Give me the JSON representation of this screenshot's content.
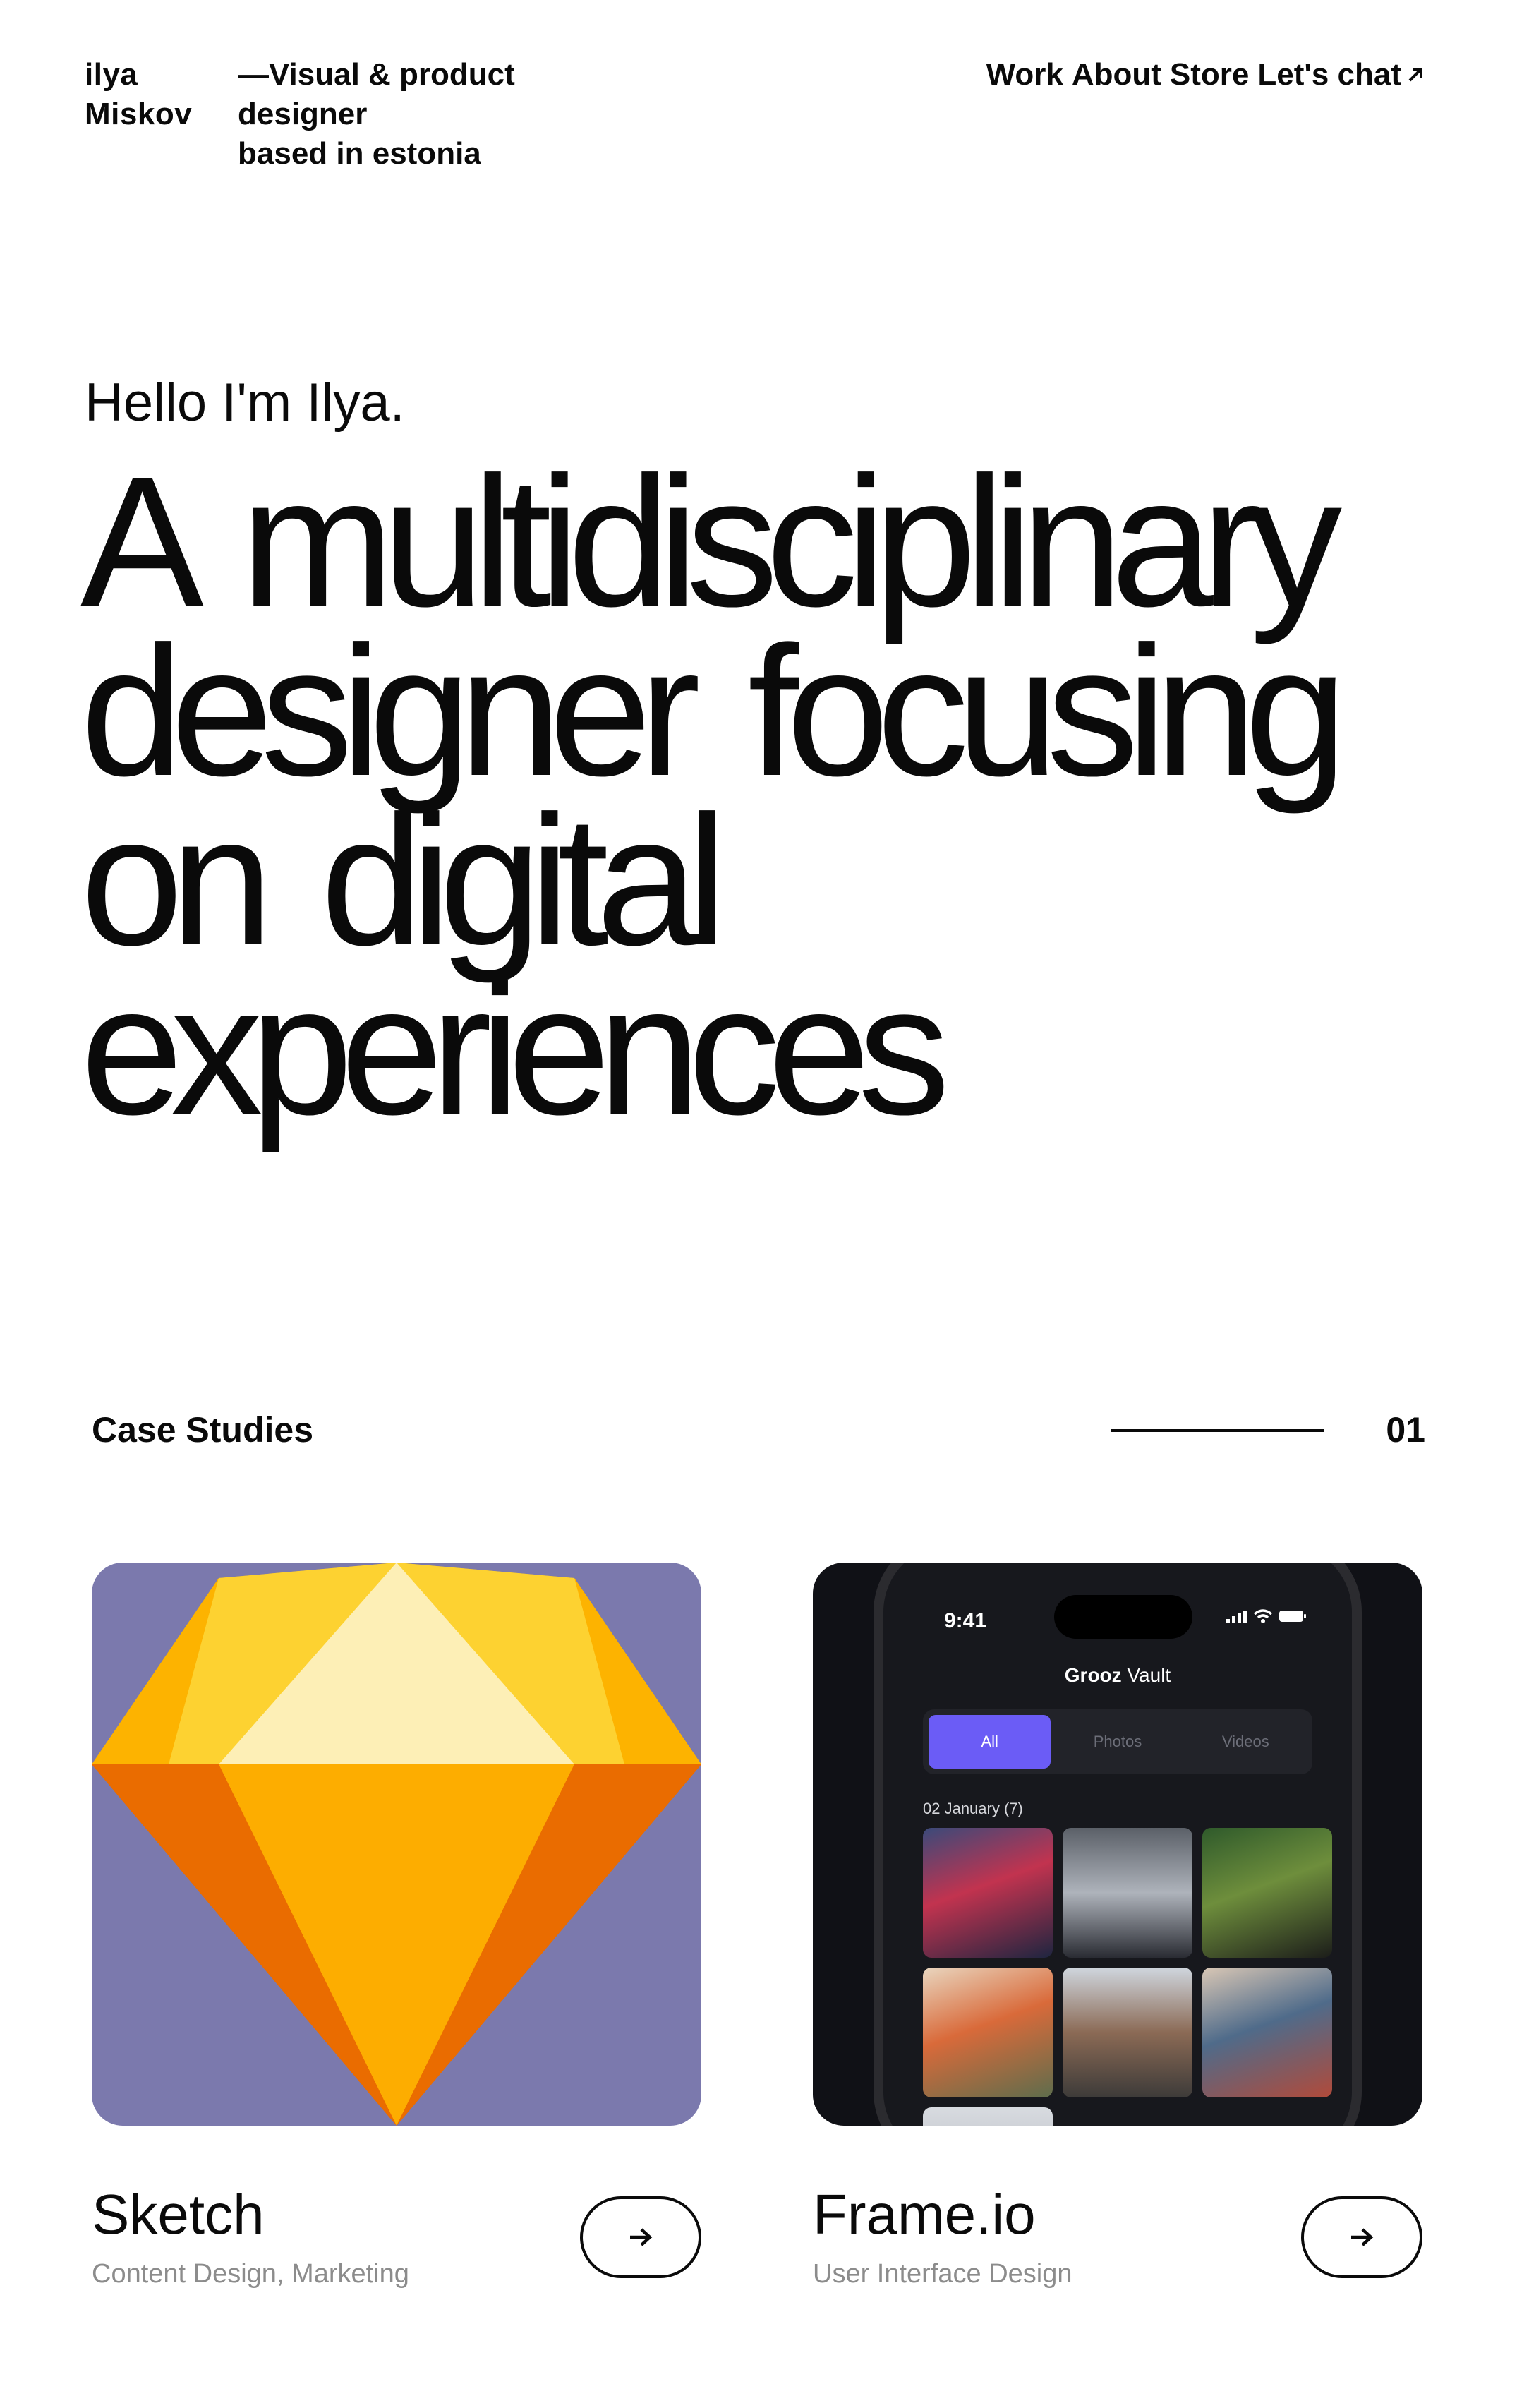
{
  "header": {
    "logo_line1": "ilya",
    "logo_line2": "Miskov",
    "tagline_line1": "—Visual & product",
    "tagline_line2": "designer",
    "tagline_line3": "based in estonia",
    "nav": {
      "work": "Work",
      "about": "About",
      "store": "Store",
      "chat": "Let's chat",
      "chat_icon": "arrow-up-right-icon"
    }
  },
  "hero": {
    "hello": "Hello I'm Ilya.",
    "headline_line1": "A multidisciplinary",
    "headline_line2": "designer focusing",
    "headline_line3": "on digital",
    "headline_line4": "experiences"
  },
  "case_studies": {
    "title": "Case Studies",
    "count": "01",
    "items": [
      {
        "title": "Sketch",
        "subtitle": "Content Design, Marketing",
        "image": "sketch-diamond-logo",
        "bg_color": "#7b79ad",
        "button_icon": "arrow-right-icon"
      },
      {
        "title": "Frame.io",
        "subtitle": "User Interface Design",
        "image": "phone-app-mockup",
        "bg_color": "#101116",
        "button_icon": "arrow-right-icon",
        "phone": {
          "time": "9:41",
          "app_name_bold": "Grooz",
          "app_name_rest": "Vault",
          "tabs": [
            "All",
            "Photos",
            "Videos"
          ],
          "date_label": "02 January (7)",
          "accent": "#6b5cf6"
        }
      }
    ]
  }
}
